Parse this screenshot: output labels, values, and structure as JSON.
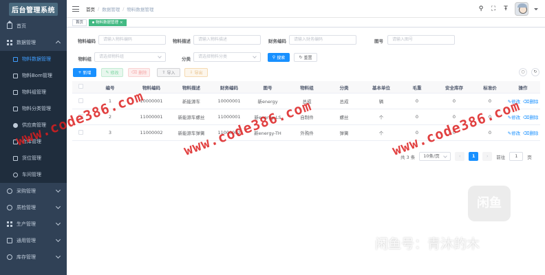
{
  "app": {
    "title": "后台管理系统"
  },
  "sidebar": {
    "items": [
      {
        "label": "首页",
        "icon": "home-icon"
      },
      {
        "label": "数据管理",
        "icon": "grid-icon",
        "open": true
      },
      {
        "label": "采购管理",
        "icon": "cart-icon"
      },
      {
        "label": "质检管理",
        "icon": "search-icon"
      },
      {
        "label": "生产管理",
        "icon": "factory-icon"
      },
      {
        "label": "通用管理",
        "icon": "doc-icon"
      },
      {
        "label": "库存管理",
        "icon": "warehouse-icon"
      }
    ],
    "sub_items": [
      {
        "label": "物料数据管理",
        "active": true
      },
      {
        "label": "物料Bom管理"
      },
      {
        "label": "物料组管理"
      },
      {
        "label": "物料分类管理"
      },
      {
        "label": "供应商管理"
      },
      {
        "label": "仓库管理"
      },
      {
        "label": "货位管理"
      },
      {
        "label": "车间管理"
      }
    ]
  },
  "header": {
    "breadcrumb": [
      "首页",
      "数据管理",
      "物料数据管理"
    ],
    "icons": [
      "search-icon",
      "fullscreen-icon",
      "font-size-icon"
    ]
  },
  "tags": [
    {
      "label": "首页",
      "active": false
    },
    {
      "label": "物料数据管理",
      "active": true
    }
  ],
  "search_form": {
    "fields": [
      {
        "label": "物料编码",
        "placeholder": "请输入物料编码"
      },
      {
        "label": "物料描述",
        "placeholder": "请输入物料描述"
      },
      {
        "label": "财务编码",
        "placeholder": "请输入财务编码"
      },
      {
        "label": "图号",
        "placeholder": "请输入图号"
      },
      {
        "label": "物料组",
        "placeholder": "请选择物料组"
      },
      {
        "label": "分类",
        "placeholder": "请选择物料分类"
      }
    ],
    "search_label": "搜索",
    "reset_label": "重置"
  },
  "toolbar": {
    "add": "新增",
    "edit": "修改",
    "delete": "删除",
    "import": "导入",
    "export": "导出"
  },
  "table": {
    "columns": [
      "编号",
      "物料编码",
      "物料描述",
      "财务编码",
      "图号",
      "物料组",
      "分类",
      "基本单位",
      "毛重",
      "安全库存",
      "标准价",
      "操作"
    ],
    "rows": [
      [
        "1",
        "10000001",
        "新能源车",
        "10000001",
        "新energy",
        "总成",
        "总成",
        "辆",
        "0",
        "0",
        "0"
      ],
      [
        "2",
        "11000001",
        "新能源车螺丝",
        "11000001",
        "新energy-LS",
        "自制件",
        "螺丝",
        "个",
        "0",
        "0",
        "0"
      ],
      [
        "3",
        "11000002",
        "新能源车弹簧",
        "11000002",
        "新energy-TH",
        "外购件",
        "弹簧",
        "个",
        "0",
        "0",
        "0"
      ]
    ],
    "row_actions": {
      "edit": "修改",
      "delete": "删除"
    }
  },
  "pagination": {
    "total": "共 3 条",
    "page_size": "10条/页",
    "current_page": "1",
    "goto_label": "前往",
    "goto_value": "1",
    "page_suffix": "页"
  },
  "watermarks": [
    "www.code386.com",
    "www.code386.com",
    "www.code386.com"
  ],
  "overlay": {
    "logo_text": "闲鱼",
    "caption": "闲鱼号：青沐的木"
  }
}
